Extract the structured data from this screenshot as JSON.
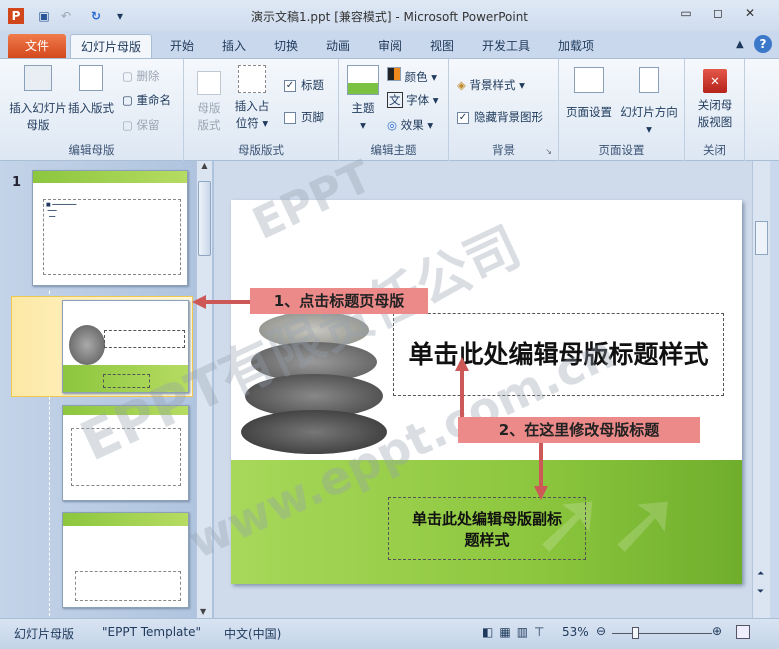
{
  "window": {
    "title": "演示文稿1.ppt [兼容模式]  -  Microsoft PowerPoint",
    "minimize": "▭",
    "restore": "◻",
    "close": "✕"
  },
  "tabs": [
    {
      "label": "文件"
    },
    {
      "label": "幻灯片母版"
    },
    {
      "label": "开始"
    },
    {
      "label": "插入"
    },
    {
      "label": "切换"
    },
    {
      "label": "动画"
    },
    {
      "label": "审阅"
    },
    {
      "label": "视图"
    },
    {
      "label": "开发工具"
    },
    {
      "label": "加载项"
    }
  ],
  "ribbon": {
    "edit_master": {
      "label": "编辑母版",
      "insert_slide_master": "插入幻灯片母版",
      "insert_layout": "插入版式",
      "delete": "删除",
      "rename": "重命名",
      "preserve": "保留"
    },
    "master_layout": {
      "label": "母版版式",
      "master_layout_btn": "母版版式",
      "insert_placeholder": "插入占位符",
      "title": "标题",
      "title_checked": true,
      "footer": "页脚",
      "footer_checked": false
    },
    "edit_theme": {
      "label": "编辑主题",
      "themes": "主题",
      "colors": "颜色",
      "fonts": "字体",
      "effects": "效果"
    },
    "background": {
      "label": "背景",
      "background_styles": "背景样式",
      "hide_bg": "隐藏背景图形",
      "hide_bg_checked": true
    },
    "page_setup": {
      "label": "页面设置",
      "page_setup_btn": "页面设置",
      "orientation": "幻灯片方向"
    },
    "close": {
      "label": "关闭",
      "close_master": "关闭母版视图"
    }
  },
  "thumbnails": {
    "slide_number": "1"
  },
  "slide": {
    "title": "单击此处编辑母版标题样式",
    "subtitle": "单击此处编辑母版副标题样式"
  },
  "annotations": {
    "step1": "1、点击标题页母版",
    "step2": "2、在这里修改母版标题"
  },
  "watermarks": [
    "EPPT",
    "EPPT有限责任公司",
    "www.eppt.com.cn"
  ],
  "status": {
    "view": "幻灯片母版",
    "theme": "\"EPPT Template\"",
    "language": "中文(中国)",
    "zoom": "53%"
  },
  "colors": {
    "file_tab": "#d2461b",
    "green": "#8cc63e",
    "note": "#ec8a8a"
  }
}
